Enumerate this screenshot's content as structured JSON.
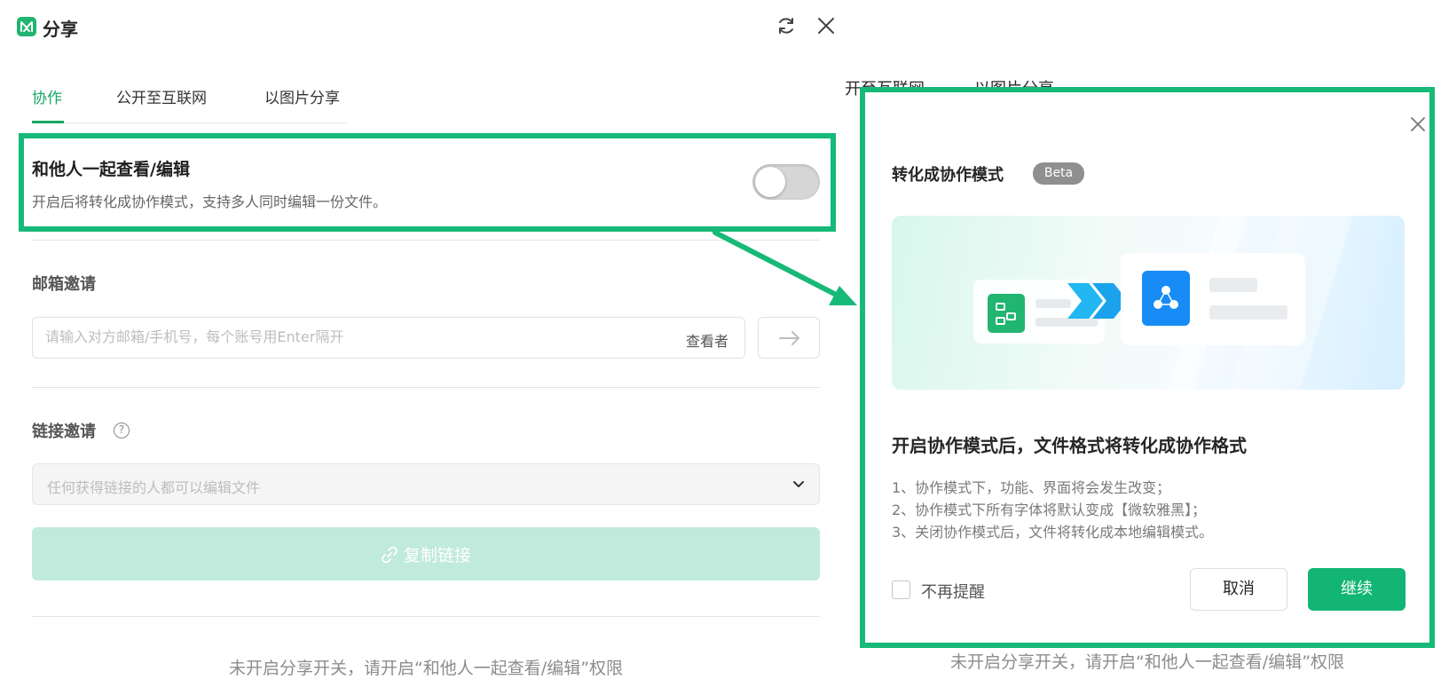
{
  "window": {
    "title": "分享",
    "icons": {
      "logo": "app-logo-icon",
      "refresh": "refresh-icon",
      "close": "close-icon"
    }
  },
  "tabs": [
    {
      "label": "协作",
      "active": true
    },
    {
      "label": "公开至互联网",
      "active": false
    },
    {
      "label": "以图片分享",
      "active": false
    }
  ],
  "collaboration": {
    "title": "和他人一起查看/编辑",
    "description": "开启后将转化成协作模式，支持多人同时编辑一份文件。",
    "toggle_on": false
  },
  "email_invite": {
    "title": "邮箱邀请",
    "placeholder": "请输入对方邮箱/手机号，每个账号用Enter隔开",
    "role": "查看者"
  },
  "link_invite": {
    "title": "链接邀请",
    "help_icon": "?",
    "permission": "任何获得链接的人都可以编辑文件",
    "copy_button": "复制链接"
  },
  "footer_hint": "未开启分享开关，请开启“和他人一起查看/编辑”权限",
  "background": {
    "tab_fragment_1": "开至互联网",
    "tab_fragment_2": "以图片分享"
  },
  "dialog": {
    "title": "转化成协作模式",
    "badge": "Beta",
    "heading": "开启协作模式后，文件格式将转化成协作格式",
    "items": [
      "1、协作模式下，功能、界面将会发生改变；",
      "2、协作模式下所有字体将默认变成【微软雅黑】；",
      "3、关闭协作模式后，文件将转化成本地编辑模式。"
    ],
    "dont_remind": "不再提醒",
    "cancel": "取消",
    "continue": "继续"
  },
  "colors": {
    "accent": "#17b978",
    "tab_active": "#18a865",
    "copy_button_disabled": "#c0eadb",
    "continue_button": "#12b573",
    "highlight_border": "#17b978"
  }
}
